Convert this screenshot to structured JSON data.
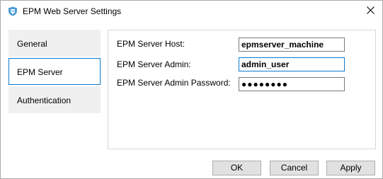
{
  "window": {
    "title": "EPM Web Server Settings",
    "app_icon": "server-shield-icon",
    "close_icon": "close-icon"
  },
  "sidebar": {
    "items": [
      {
        "label": "General",
        "selected": false
      },
      {
        "label": "EPM Server",
        "selected": true
      },
      {
        "label": "Authentication",
        "selected": false
      }
    ]
  },
  "form": {
    "host_label": "EPM Server Host:",
    "host_value": "epmserver_machine",
    "admin_label": "EPM Server Admin:",
    "admin_value": "admin_user",
    "password_label": "EPM Server Admin Password:",
    "password_value": "●●●●●●●●"
  },
  "buttons": {
    "ok": "OK",
    "cancel": "Cancel",
    "apply": "Apply"
  },
  "colors": {
    "focus_accent": "#0a7acc",
    "sidebar_bg": "#f0f0f0",
    "button_bg": "#e1e1e1"
  }
}
